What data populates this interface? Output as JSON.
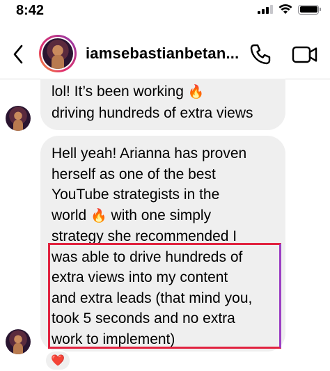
{
  "status_bar": {
    "time": "8:42"
  },
  "header": {
    "username": "iamsebastianbetan...",
    "icons": [
      "back-chevron-icon",
      "phone-icon",
      "video-camera-icon"
    ]
  },
  "messages": [
    {
      "lines": [
        {
          "text": "lol! It’s been working ",
          "emoji": "🔥"
        },
        {
          "text": "driving hundreds of extra views",
          "emoji": ""
        }
      ]
    },
    {
      "lines": [
        {
          "text": "Hell yeah! Arianna has proven",
          "emoji": ""
        },
        {
          "text": "herself as one of the best",
          "emoji": ""
        },
        {
          "text": "YouTube strategists in the",
          "emoji": ""
        },
        {
          "text": "world ",
          "emoji": "🔥",
          "after": " with one simply"
        },
        {
          "text": "strategy she recommended I",
          "emoji": ""
        },
        {
          "text": "was able to drive hundreds of",
          "emoji": ""
        },
        {
          "text": "extra views into my content",
          "emoji": ""
        },
        {
          "text": "and extra leads (that mind you,",
          "emoji": ""
        },
        {
          "text": "took 5 seconds and no extra",
          "emoji": ""
        },
        {
          "text": "work to implement)",
          "emoji": ""
        }
      ],
      "reaction": "❤️"
    }
  ],
  "colors": {
    "bubble": "#efefef",
    "highlight": "#e1233f",
    "reaction_heart": "#ed2a3b"
  }
}
